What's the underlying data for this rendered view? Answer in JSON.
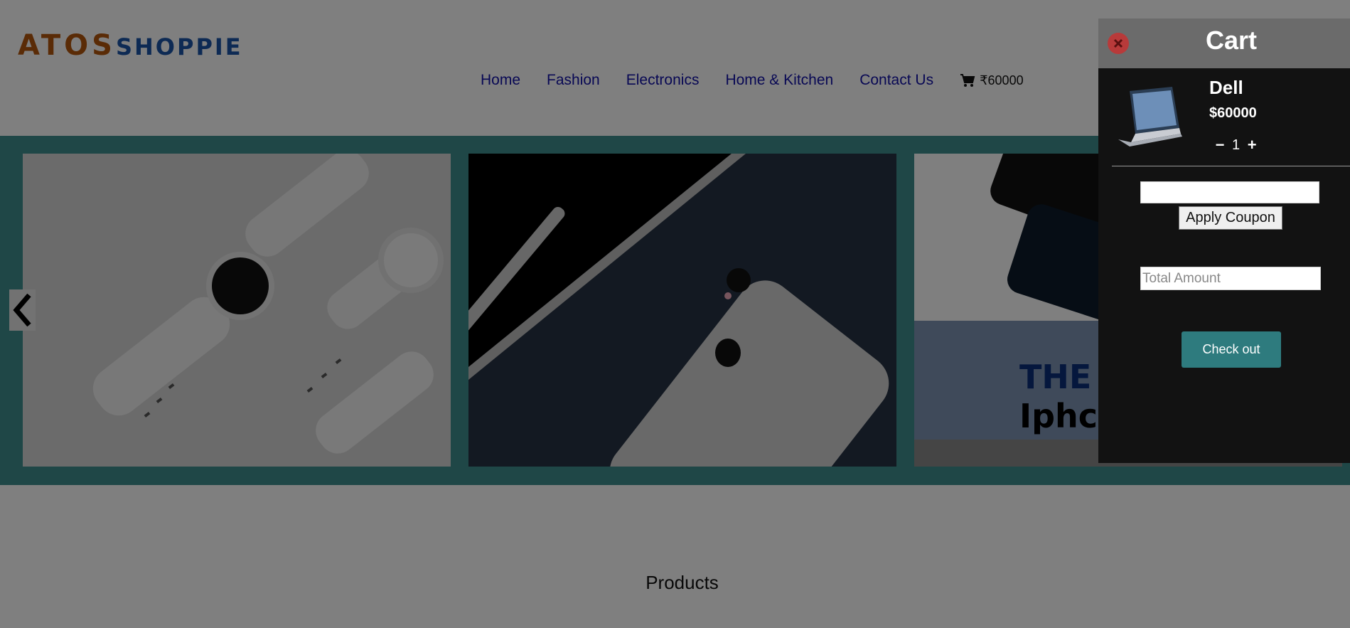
{
  "brand": {
    "part1": "ATOS",
    "part2": "SHOPPIE",
    "color1": "#b5570d",
    "color2": "#1a55a8"
  },
  "nav": {
    "items": [
      "Home",
      "Fashion",
      "Electronics",
      "Home & Kitchen",
      "Contact Us"
    ],
    "cart_icon": "cart-icon",
    "cart_total": "₹60000"
  },
  "carousel": {
    "prev_icon": "chevron-left-icon",
    "slides": [
      "smartwatch-image",
      "ipad-iphone-image",
      "iphone-promo-image"
    ],
    "slide3_text_line1": "THE",
    "slide3_text_line2": "Iphc"
  },
  "products": {
    "title": "Products"
  },
  "cart": {
    "title": "Cart",
    "close_icon": "close-icon",
    "item": {
      "name": "Dell",
      "price": "$60000",
      "quantity": "1",
      "decrease_label": "−",
      "increase_label": "+"
    },
    "coupon": {
      "value": "",
      "apply_label": "Apply Coupon"
    },
    "total_placeholder": "Total Amount",
    "checkout_label": "Check out",
    "accent": "#2e7b7e"
  }
}
